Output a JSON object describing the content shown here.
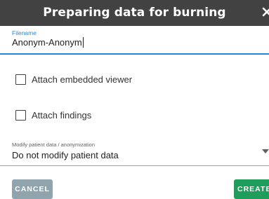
{
  "dialog": {
    "title": "Preparing data for burning",
    "close_label": "✕"
  },
  "filename": {
    "label": "Filename",
    "value": "Anonym-Anonym"
  },
  "options": {
    "embedded_viewer_label": "Attach embedded viewer",
    "embedded_viewer_checked": false,
    "findings_label": "Attach findings",
    "findings_checked": false
  },
  "modify": {
    "label": "Modify patient data / anonymization",
    "selected": "Do not modify patient data"
  },
  "buttons": {
    "cancel": "CANCEL",
    "create": "CREATE"
  },
  "colors": {
    "titlebar": "#424242",
    "accent": "#1e88e5",
    "cancel_bg": "#90a4ae",
    "create_bg": "#1e9e5a"
  }
}
